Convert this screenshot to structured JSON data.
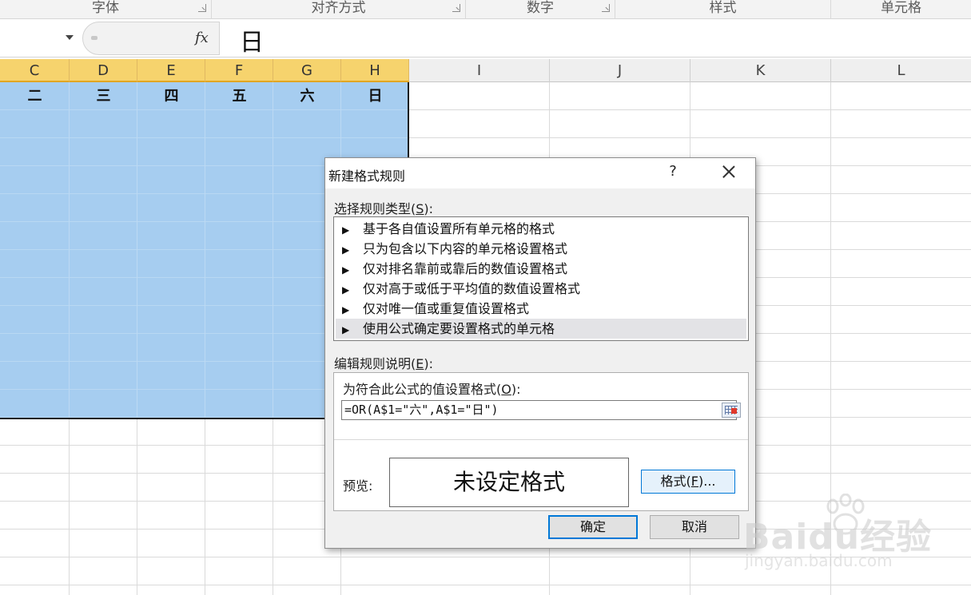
{
  "ribbon": {
    "groups": [
      {
        "label": "字体"
      },
      {
        "label": "对齐方式"
      },
      {
        "label": "数字"
      },
      {
        "label": "样式"
      },
      {
        "label": "单元格"
      }
    ]
  },
  "formula_bar": {
    "fx_label": "fx",
    "content": "日"
  },
  "columns": [
    "C",
    "D",
    "E",
    "F",
    "G",
    "H",
    "I",
    "J",
    "K",
    "L"
  ],
  "selected_columns": [
    "C",
    "D",
    "E",
    "F",
    "G",
    "H"
  ],
  "day_headers": [
    "二",
    "三",
    "四",
    "五",
    "六",
    "日"
  ],
  "colors": {
    "selection_fill": "#a6cdf0",
    "selected_header": "#f6d36d",
    "accent_border": "#0078d7"
  },
  "dialog": {
    "title": "新建格式规则",
    "help": "?",
    "rule_type_label": "选择规则类型",
    "rule_type_key": "S",
    "rule_types": [
      "基于各自值设置所有单元格的格式",
      "只为包含以下内容的单元格设置格式",
      "仅对排名靠前或靠后的数值设置格式",
      "仅对高于或低于平均值的数值设置格式",
      "仅对唯一值或重复值设置格式",
      "使用公式确定要设置格式的单元格"
    ],
    "selected_rule_index": 5,
    "description_label": "编辑规则说明",
    "description_key": "E",
    "formula_label": "为符合此公式的值设置格式",
    "formula_key": "O",
    "formula_value": "=OR(A$1=\"六\",A$1=\"日\")",
    "preview_label": "预览:",
    "preview_text": "未设定格式",
    "format_button": "格式",
    "format_key": "F",
    "ok_button": "确定",
    "cancel_button": "取消"
  },
  "watermark": {
    "brand": "Baidu经验",
    "url": "jingyan.baidu.com"
  }
}
